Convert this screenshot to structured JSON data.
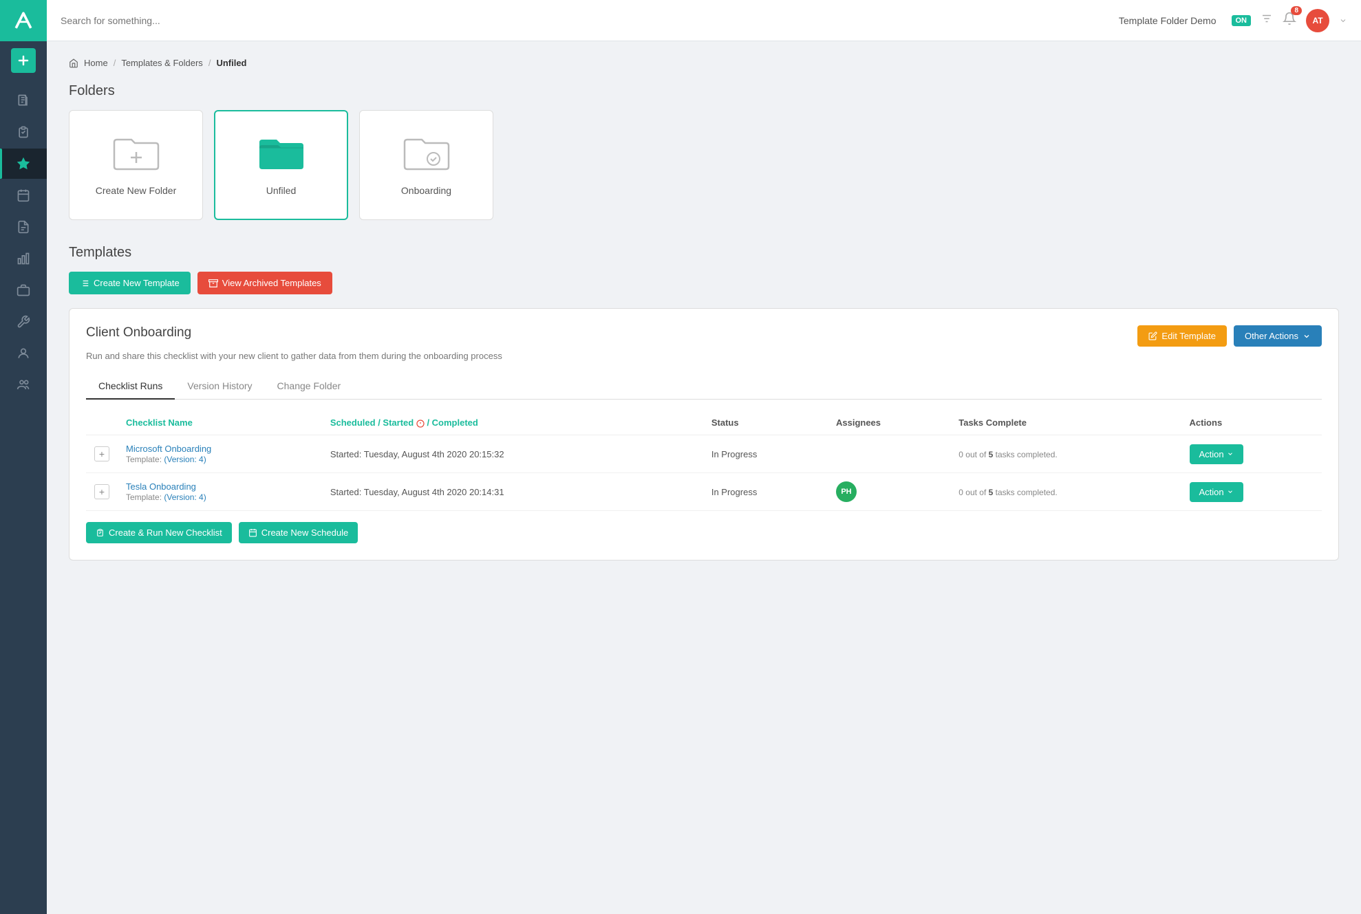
{
  "topbar": {
    "search_placeholder": "Search for something...",
    "app_title": "Template Folder Demo",
    "badge_on": "ON",
    "badge_num": "8",
    "avatar_initials": "AT"
  },
  "breadcrumb": {
    "home": "Home",
    "templates": "Templates & Folders",
    "current": "Unfiled"
  },
  "folders_section": {
    "title": "Folders",
    "cards": [
      {
        "label": "Create New Folder",
        "type": "create"
      },
      {
        "label": "Unfiled",
        "type": "unfiled",
        "selected": true
      },
      {
        "label": "Onboarding",
        "type": "onboarding"
      }
    ]
  },
  "templates_section": {
    "title": "Templates",
    "btn_create": "Create New Template",
    "btn_archived": "View Archived Templates"
  },
  "template_card": {
    "title": "Client Onboarding",
    "description": "Run and share this checklist with your new client to gather data from them during the onboarding process",
    "btn_edit": "Edit Template",
    "btn_other": "Other Actions",
    "tabs": [
      {
        "label": "Checklist Runs",
        "active": true
      },
      {
        "label": "Version History",
        "active": false
      },
      {
        "label": "Change Folder",
        "active": false
      }
    ],
    "table": {
      "headers": [
        {
          "label": "",
          "color": "gray"
        },
        {
          "label": "Checklist Name",
          "color": "teal"
        },
        {
          "label": "Scheduled / Started  / Completed",
          "color": "teal"
        },
        {
          "label": "Status",
          "color": "gray"
        },
        {
          "label": "Assignees",
          "color": "gray"
        },
        {
          "label": "Tasks Complete",
          "color": "gray"
        },
        {
          "label": "Actions",
          "color": "gray"
        }
      ],
      "rows": [
        {
          "name": "Microsoft Onboarding",
          "version": "(Version: 4)",
          "started": "Started: Tuesday, August 4th 2020 20:15:32",
          "status": "In Progress",
          "assignees": [],
          "tasks_done": "0",
          "tasks_total": "5",
          "tasks_label": "tasks completed.",
          "action_label": "Action"
        },
        {
          "name": "Tesla Onboarding",
          "version": "(Version: 4)",
          "started": "Started: Tuesday, August 4th 2020 20:14:31",
          "status": "In Progress",
          "assignees": [
            "PH"
          ],
          "tasks_done": "0",
          "tasks_total": "5",
          "tasks_label": "tasks completed.",
          "action_label": "Action"
        }
      ]
    },
    "btn_create_run": "Create & Run New Checklist",
    "btn_create_schedule": "Create New Schedule"
  },
  "sidebar": {
    "icons": [
      {
        "name": "document-icon",
        "label": "Documents"
      },
      {
        "name": "checklist-icon",
        "label": "Checklists"
      },
      {
        "name": "star-icon",
        "label": "Favorites",
        "active": true
      },
      {
        "name": "calendar-icon",
        "label": "Calendar"
      },
      {
        "name": "report-icon",
        "label": "Reports"
      },
      {
        "name": "chart-icon",
        "label": "Charts"
      },
      {
        "name": "briefcase-icon",
        "label": "Briefcase"
      },
      {
        "name": "wrench-icon",
        "label": "Settings"
      },
      {
        "name": "person-icon",
        "label": "Person"
      },
      {
        "name": "team-icon",
        "label": "Team"
      }
    ]
  }
}
